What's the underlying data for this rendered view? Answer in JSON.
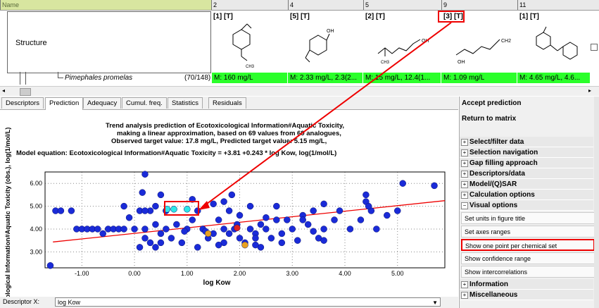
{
  "matrix": {
    "header_name": "Name",
    "columns": [
      "2",
      "4",
      "5",
      "9",
      "11"
    ],
    "row_label": "Structure",
    "chem_tags": [
      "[1] [T]",
      "[5] [T]",
      "[2] [T]",
      "[3] [T]",
      "[1] [T]"
    ],
    "chem_atoms": [
      [
        "CH3"
      ],
      [
        "OH"
      ],
      [
        "OH",
        "CH3"
      ],
      [
        "CH2",
        "OH"
      ],
      []
    ],
    "species": "Pimephales promelas",
    "count": "(70/148)",
    "values": [
      "M: 160 mg/L",
      "M: 2.33 mg/L, 2.3(2...",
      "M: 15 mg/L, 12.4(1...",
      "M: 1.09 mg/L",
      "M: 4.65 mg/L, 4.6..."
    ]
  },
  "tabs": [
    "Descriptors",
    "Prediction",
    "Adequacy",
    "Cumul. freq.",
    "Statistics",
    "Residuals"
  ],
  "active_tab": "Prediction",
  "plot": {
    "title_lines": [
      "Trend analysis prediction of Ecotoxicological Information#Aquatic Toxicity,",
      "making a linear approximation, based on 69 values from 69 analogues,",
      "Observed target value: 17.8 mg/L, Predicted target value: 5.15 mg/L,"
    ],
    "equation": "Model equation:  Ecotoxicological Information#Aquatic Toxicity  = +3.81 +0.243 * log Kow,  log(1/mol/L)"
  },
  "chart_data": {
    "type": "scatter",
    "xlabel": "log Kow",
    "ylabel": "ological Information#Aquatic Toxicity (obs.), log(1/mol/L)",
    "xlim": [
      -1.7,
      5.9
    ],
    "ylim": [
      2.3,
      6.5
    ],
    "xticks": [
      "-1.00",
      "0.00",
      "1.00",
      "2.00",
      "3.00",
      "4.00",
      "5.00"
    ],
    "yticks": [
      "3.00",
      "4.00",
      "5.00",
      "6.00"
    ],
    "grid": true,
    "regression": {
      "intercept": 3.81,
      "slope": 0.243
    },
    "series": [
      {
        "color": "#1a2bd8",
        "points": [
          [
            -1.6,
            2.4
          ],
          [
            -1.5,
            4.8
          ],
          [
            -1.4,
            4.8
          ],
          [
            -1.2,
            4.8
          ],
          [
            -1.1,
            4.0
          ],
          [
            -1.0,
            4.0
          ],
          [
            -0.9,
            4.0
          ],
          [
            -0.8,
            4.0
          ],
          [
            -0.7,
            4.0
          ],
          [
            -0.6,
            3.8
          ],
          [
            -0.5,
            4.0
          ],
          [
            -0.4,
            4.0
          ],
          [
            -0.3,
            4.0
          ],
          [
            -0.2,
            4.0
          ],
          [
            -0.1,
            4.5
          ],
          [
            0.0,
            4.0
          ],
          [
            0.1,
            3.2
          ],
          [
            0.1,
            4.8
          ],
          [
            0.2,
            4.0
          ],
          [
            0.2,
            3.6
          ],
          [
            0.3,
            4.8
          ],
          [
            0.3,
            3.4
          ],
          [
            0.4,
            3.2
          ],
          [
            0.4,
            4.2
          ],
          [
            0.4,
            5.0
          ],
          [
            0.5,
            3.8
          ],
          [
            0.5,
            3.4
          ],
          [
            0.6,
            4.0
          ],
          [
            0.6,
            4.8
          ],
          [
            0.2,
            4.8
          ],
          [
            -0.2,
            5.0
          ],
          [
            0.7,
            3.6
          ],
          [
            0.8,
            4.2
          ],
          [
            0.9,
            3.4
          ],
          [
            1.0,
            4.0
          ],
          [
            1.1,
            4.4
          ],
          [
            1.2,
            3.2
          ],
          [
            1.2,
            4.8
          ],
          [
            1.3,
            4.0
          ],
          [
            1.4,
            3.6
          ],
          [
            1.5,
            3.8
          ],
          [
            1.5,
            5.1
          ],
          [
            1.6,
            4.4
          ],
          [
            1.7,
            4.0
          ],
          [
            1.7,
            3.4
          ],
          [
            1.8,
            4.8
          ],
          [
            1.8,
            3.8
          ],
          [
            1.9,
            4.0
          ],
          [
            2.0,
            3.6
          ],
          [
            2.0,
            4.6
          ],
          [
            2.1,
            3.4
          ],
          [
            2.2,
            4.0
          ],
          [
            2.2,
            5.0
          ],
          [
            2.3,
            3.8
          ],
          [
            2.4,
            4.2
          ],
          [
            2.4,
            3.2
          ],
          [
            2.5,
            4.0
          ],
          [
            2.6,
            3.6
          ],
          [
            2.7,
            4.4
          ],
          [
            2.7,
            5.0
          ],
          [
            2.8,
            3.8
          ],
          [
            2.9,
            4.4
          ],
          [
            3.0,
            4.0
          ],
          [
            3.1,
            3.5
          ],
          [
            3.2,
            4.6
          ],
          [
            3.3,
            4.2
          ],
          [
            3.4,
            4.8
          ],
          [
            3.5,
            3.6
          ],
          [
            3.6,
            4.0
          ],
          [
            3.8,
            4.4
          ],
          [
            3.9,
            4.8
          ],
          [
            4.1,
            4.0
          ],
          [
            4.3,
            4.4
          ],
          [
            4.4,
            5.2
          ],
          [
            4.5,
            4.8
          ],
          [
            4.6,
            4.0
          ],
          [
            4.8,
            4.6
          ],
          [
            5.0,
            4.8
          ],
          [
            5.1,
            6.0
          ],
          [
            5.7,
            5.9
          ],
          [
            3.6,
            3.5
          ],
          [
            2.5,
            4.5
          ],
          [
            0.95,
            3.9
          ],
          [
            1.35,
            3.9
          ],
          [
            1.95,
            4.2
          ],
          [
            1.6,
            3.3
          ],
          [
            2.3,
            3.3
          ],
          [
            0.2,
            6.4
          ],
          [
            0.15,
            5.6
          ],
          [
            1.1,
            5.3
          ],
          [
            1.7,
            5.2
          ],
          [
            1.85,
            5.5
          ],
          [
            3.6,
            5.1
          ],
          [
            4.4,
            5.5
          ],
          [
            4.45,
            5.0
          ],
          [
            2.3,
            3.6
          ],
          [
            3.4,
            3.9
          ],
          [
            0.5,
            5.5
          ],
          [
            2.8,
            3.4
          ],
          [
            3.2,
            4.4
          ]
        ]
      },
      {
        "color": "#2ee6e6",
        "points": [
          [
            0.62,
            4.87
          ],
          [
            0.75,
            4.87
          ],
          [
            1.0,
            4.87
          ]
        ]
      },
      {
        "color": "#e8a020",
        "points": [
          [
            1.4,
            3.8
          ],
          [
            2.1,
            3.3
          ]
        ]
      },
      {
        "color": "#e02020",
        "points": [
          [
            1.95,
            4.05
          ]
        ]
      }
    ]
  },
  "right_panel": {
    "top_buttons": [
      "Accept prediction",
      "Return to matrix"
    ],
    "sections_top": [
      "Select/filter data",
      "Selection navigation",
      "Gap filling approach",
      "Descriptors/data",
      "Model/(Q)SAR",
      "Calculation options"
    ],
    "visual_section": "Visual options",
    "visual_options": [
      "Set units in figure title",
      "Set axes ranges",
      "Show one point per chemical set",
      "Show confidence range",
      "Show intercorrelations"
    ],
    "sections_bottom": [
      "Information",
      "Miscellaneous"
    ]
  },
  "bottom": {
    "label": "Descriptor X:",
    "select_value": "log Kow"
  }
}
